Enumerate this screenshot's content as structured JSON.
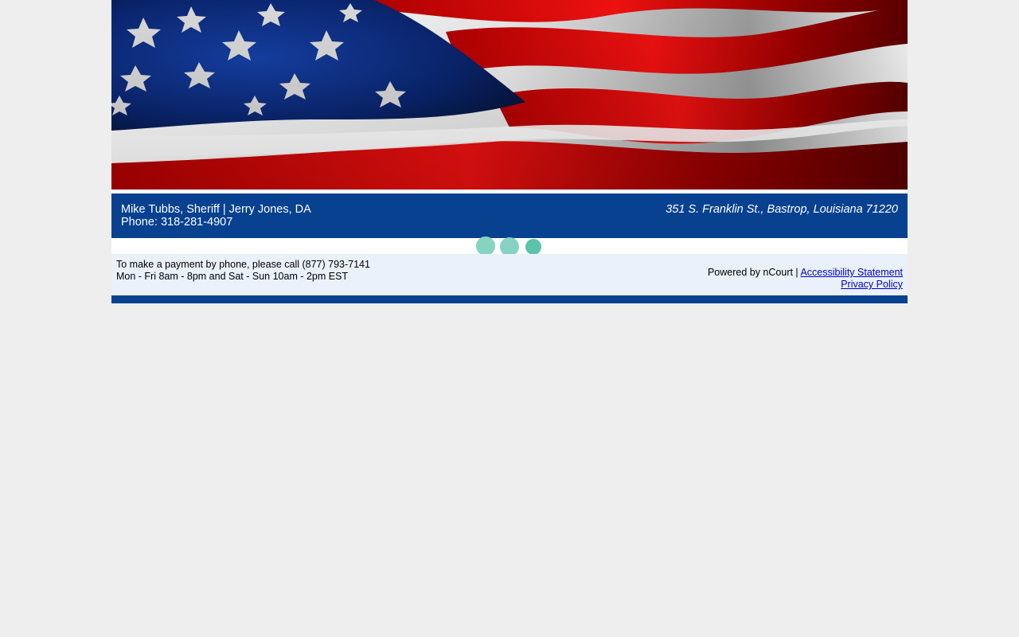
{
  "header": {
    "officials": "Mike Tubbs, Sheriff | Jerry Jones, DA",
    "phone": "Phone: 318-281-4907",
    "address": "351 S. Franklin St., Bastrop, Louisiana 71220"
  },
  "footer": {
    "payment_line": "To make a payment by phone, please call (877) 793-7141",
    "hours_line": "Mon - Fri 8am - 8pm and Sat - Sun 10am - 2pm EST",
    "powered_by": "Powered by nCourt | ",
    "accessibility_link": "Accessibility Statement",
    "privacy_link": "Privacy Policy"
  },
  "colors": {
    "brand_blue": "#074190",
    "footer_bg": "#eaf1fb",
    "loader_dot": "#85d3c0",
    "loader_dot_active": "#5cc4a8",
    "page_bg": "#eeeeee"
  },
  "icons": {
    "banner": "american-flag-image",
    "loader": "loading-dots-icon"
  }
}
